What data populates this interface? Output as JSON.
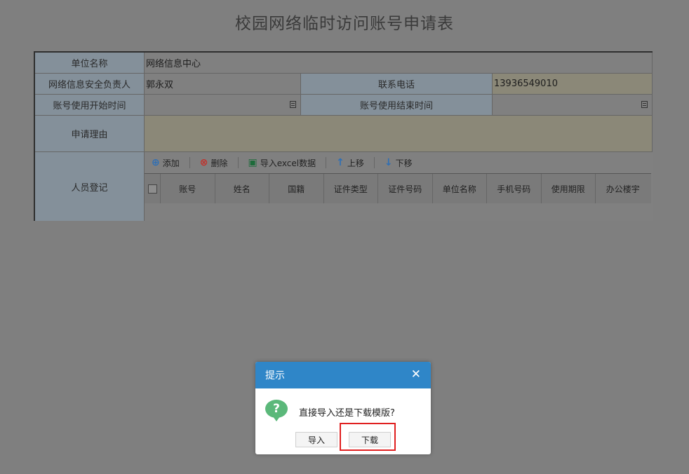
{
  "page": {
    "title": "校园网络临时访问账号申请表"
  },
  "form": {
    "unit_name_label": "单位名称",
    "unit_name_value": "网络信息中心",
    "security_owner_label": "网络信息安全负责人",
    "security_owner_value": "郭永双",
    "phone_label": "联系电话",
    "phone_value": "13936549010",
    "start_time_label": "账号使用开始时间",
    "start_time_value": "",
    "end_time_label": "账号使用结束时间",
    "end_time_value": "",
    "reason_label": "申请理由",
    "reason_value": "",
    "personnel_label": "人员登记"
  },
  "toolbar": {
    "add": "添加",
    "delete": "删除",
    "import_excel": "导入excel数据",
    "move_up": "上移",
    "move_down": "下移"
  },
  "grid": {
    "columns": [
      "账号",
      "姓名",
      "国籍",
      "证件类型",
      "证件号码",
      "单位名称",
      "手机号码",
      "使用期限",
      "办公楼宇"
    ]
  },
  "dialog": {
    "title": "提示",
    "message": "直接导入还是下载模版?",
    "import_button": "导入",
    "download_button": "下载"
  },
  "colors": {
    "dialog_header": "#2f86c8",
    "highlight": "#e02020",
    "question_icon": "#5bb87a"
  }
}
